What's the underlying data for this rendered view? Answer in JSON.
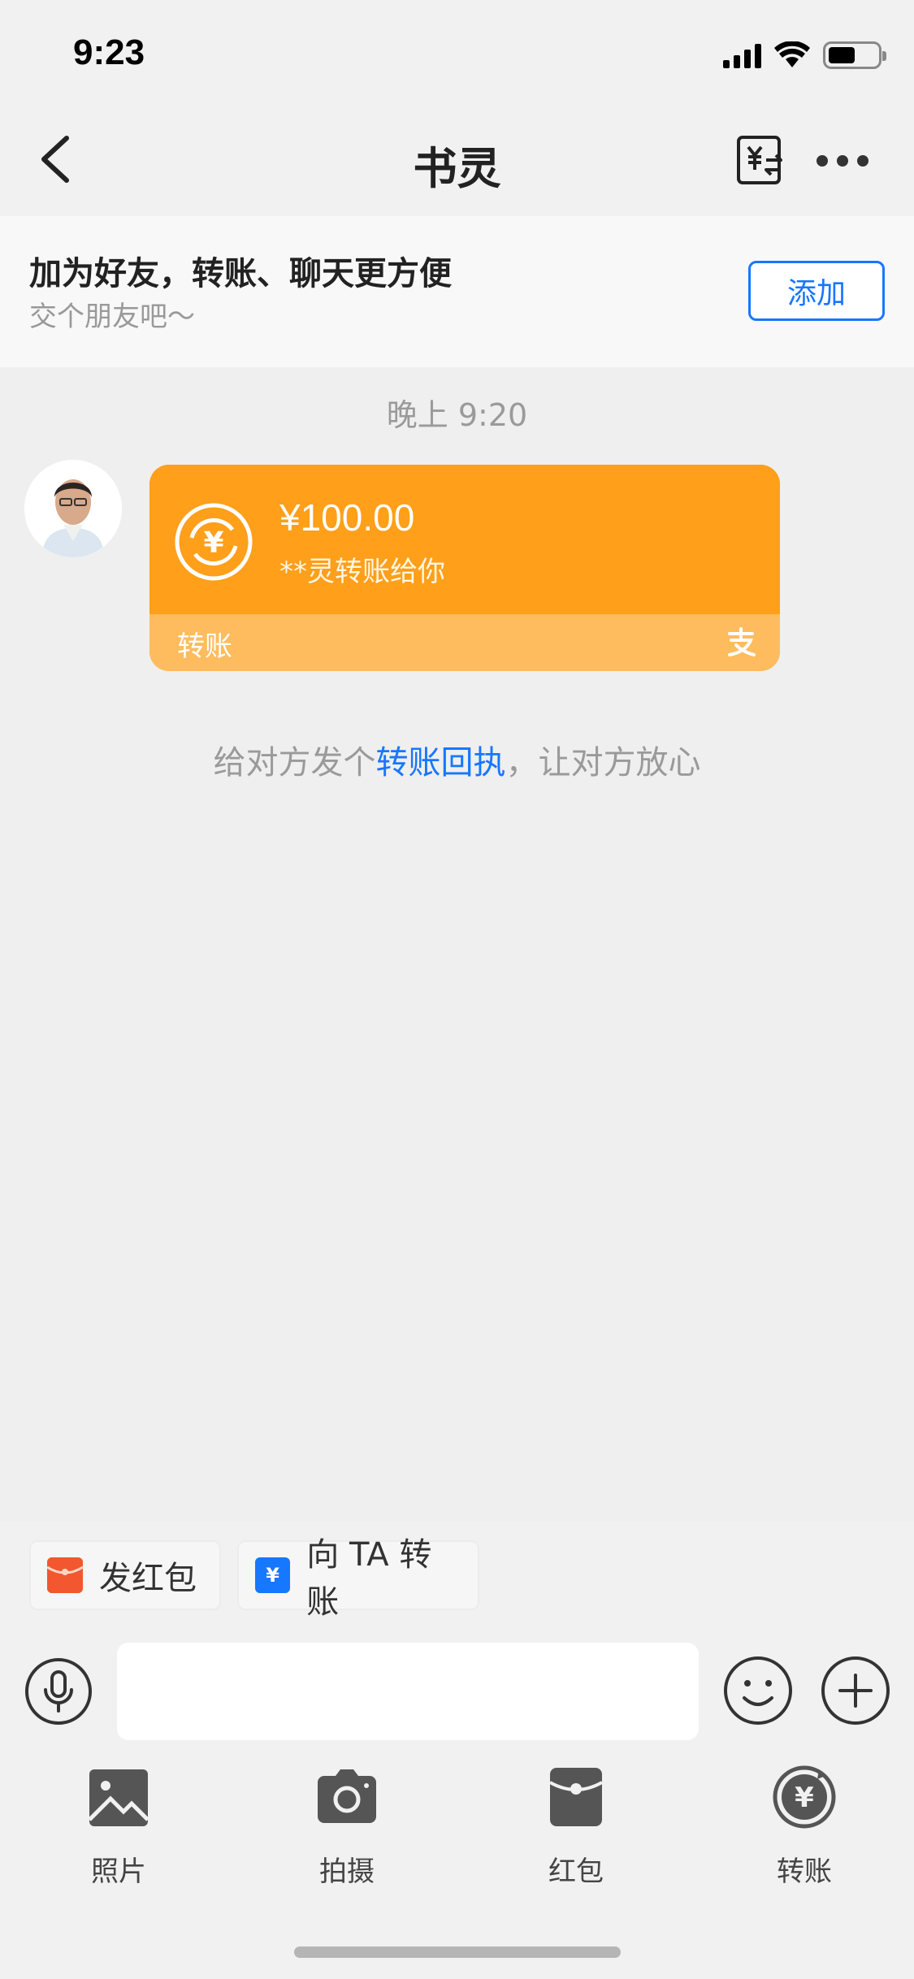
{
  "status_bar": {
    "time": "9:23",
    "battery_level": 0.55
  },
  "header": {
    "title": "书灵",
    "back_icon": "chevron-left-icon",
    "transfer_icon": "yuan-exchange-icon",
    "more_icon": "more-dots-icon"
  },
  "friend_banner": {
    "title": "加为好友，转账、聊天更方便",
    "subtitle": "交个朋友吧～",
    "add_label": "添加"
  },
  "chat": {
    "time": "晚上 9:20",
    "transfer_card": {
      "amount": "¥100.00",
      "description": "**灵转账给你",
      "label": "转账",
      "card_color": "#ff9f1a",
      "footer_color": "#ffbc5e"
    },
    "receipt_hint": {
      "before": "给对方发个",
      "link": "转账回执",
      "after": "，让对方放心"
    }
  },
  "quick_actions": {
    "red_packet": "发红包",
    "transfer": "向 TA 转账"
  },
  "input": {
    "placeholder": ""
  },
  "tools": {
    "photo": "照片",
    "camera": "拍摄",
    "red_packet": "红包",
    "transfer": "转账"
  },
  "colors": {
    "accent": "#1677ff",
    "transfer_orange": "#ff9f1a",
    "red_packet": "#f2572f"
  }
}
